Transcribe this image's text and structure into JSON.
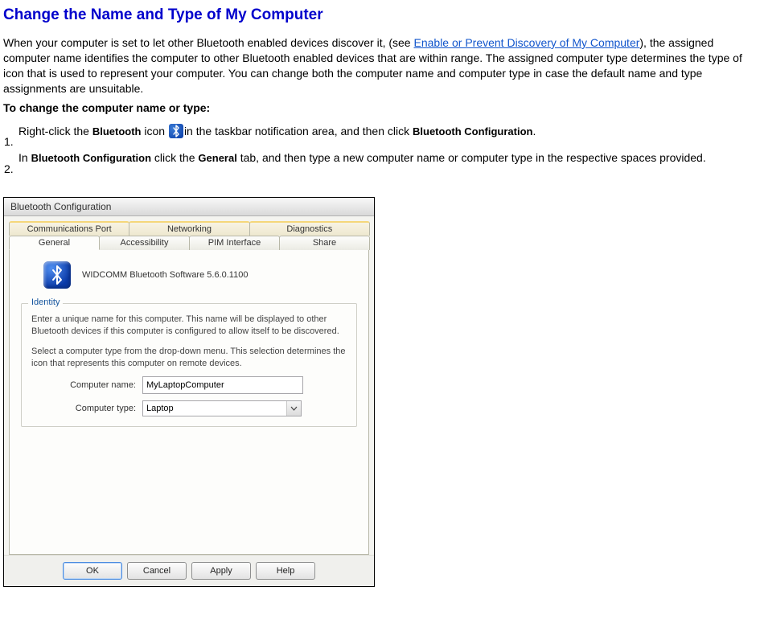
{
  "page": {
    "title": "Change the Name and Type of My Computer",
    "intro_before_link": "When your computer is set to let other Bluetooth enabled devices discover it, (see ",
    "link_text": "Enable or Prevent Discovery of My Computer",
    "intro_after_link": "), the assigned computer name identifies the computer to other Bluetooth enabled devices that are within range. The assigned computer type determines the type of icon that is used to represent your computer. You can change both the computer name and computer type in case the default name and type assignments are unsuitable.",
    "subhead": "To change the computer name or type:",
    "steps": {
      "s1_a": "Right-click the ",
      "s1_bold1": "Bluetooth",
      "s1_b": " icon ",
      "s1_c": "in the taskbar notification area, and then click ",
      "s1_bold2": "Bluetooth Configuration",
      "s1_d": ".",
      "s2_a": "In ",
      "s2_bold1": "Bluetooth Configuration",
      "s2_b": " click the ",
      "s2_bold2": "General",
      "s2_c": " tab, and then type a new computer name or computer type in the respective spaces provided."
    }
  },
  "dialog": {
    "title": "Bluetooth Configuration",
    "tabs_back": [
      "Communications Port",
      "Networking",
      "Diagnostics"
    ],
    "tabs_front": [
      "General",
      "Accessibility",
      "PIM Interface",
      "Share"
    ],
    "software_line": "WIDCOMM Bluetooth Software 5.6.0.1100",
    "identity": {
      "legend": "Identity",
      "para1": "Enter a unique name for this computer.  This name will be displayed to other Bluetooth devices if this computer is configured to allow itself to be discovered.",
      "para2": "Select a computer type from the drop-down menu.  This selection determines the icon that represents this computer on remote devices.",
      "name_label": "Computer name:",
      "name_value": "MyLaptopComputer",
      "type_label": "Computer type:",
      "type_value": "Laptop"
    },
    "buttons": {
      "ok": "OK",
      "cancel": "Cancel",
      "apply": "Apply",
      "help": "Help"
    }
  }
}
